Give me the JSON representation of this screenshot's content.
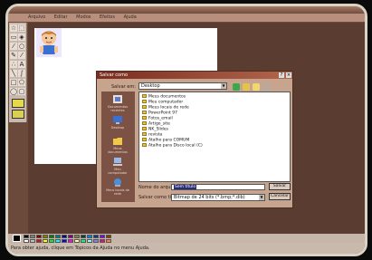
{
  "app": {
    "menu": [
      "Arquivo",
      "Editar",
      "Modos",
      "Efeitos",
      "Ajuda"
    ],
    "status_text": "Para obter ajuda, clique em Tópicos da Ajuda no menu Ajuda."
  },
  "toolbox": {
    "tools": [
      "star-tool",
      "select-tool",
      "eraser-tool",
      "fill-tool",
      "eyedropper-tool",
      "zoom-tool",
      "pencil-tool",
      "brush-tool",
      "airbrush-tool",
      "text-tool",
      "line-tool",
      "curve-tool",
      "rect-tool",
      "polygon-tool",
      "ellipse-tool",
      "roundrect-tool"
    ]
  },
  "palette": {
    "current_color": "#000000",
    "colors": [
      "#000000",
      "#808080",
      "#800000",
      "#808000",
      "#008000",
      "#008080",
      "#000080",
      "#800080",
      "#808040",
      "#004040",
      "#0080ff",
      "#004080",
      "#8000ff",
      "#804000",
      "#ffffff",
      "#c0c0c0",
      "#ff0000",
      "#ffff00",
      "#00ff00",
      "#00ffff",
      "#0000ff",
      "#ff00ff",
      "#ffff80",
      "#00ff80",
      "#80ffff",
      "#8080ff",
      "#ff0080",
      "#ff8040"
    ]
  },
  "dialog": {
    "title": "Salvar como",
    "save_in_label": "Salvar em:",
    "save_in_value": "Desktop",
    "places": [
      {
        "label": "Documentos recentes",
        "icon": "recent-docs-icon"
      },
      {
        "label": "Desktop",
        "icon": "desktop-icon"
      },
      {
        "label": "Meus documentos",
        "icon": "my-documents-icon"
      },
      {
        "label": "Meu computador",
        "icon": "my-computer-icon"
      },
      {
        "label": "Meus locais de rede",
        "icon": "network-places-icon"
      }
    ],
    "files": [
      "Meus documentos",
      "Meu computador",
      "Meus locais de rede",
      "PowerPoint 97",
      "Fotos_email",
      "Artigo_site",
      "NK_Slides",
      "revista",
      "Atalho para COMUM",
      "Atalho para Disco local (C)"
    ],
    "filename_label": "Nome do arquivo:",
    "filename_value": "Sem título",
    "filetype_label": "Salvar como tipo:",
    "filetype_value": "Bitmap de 24 bits (*.bmp;*.dib)",
    "save_button": "Salvar",
    "cancel_button": "Cancelar",
    "help_glyph": "?",
    "close_glyph": "×"
  }
}
